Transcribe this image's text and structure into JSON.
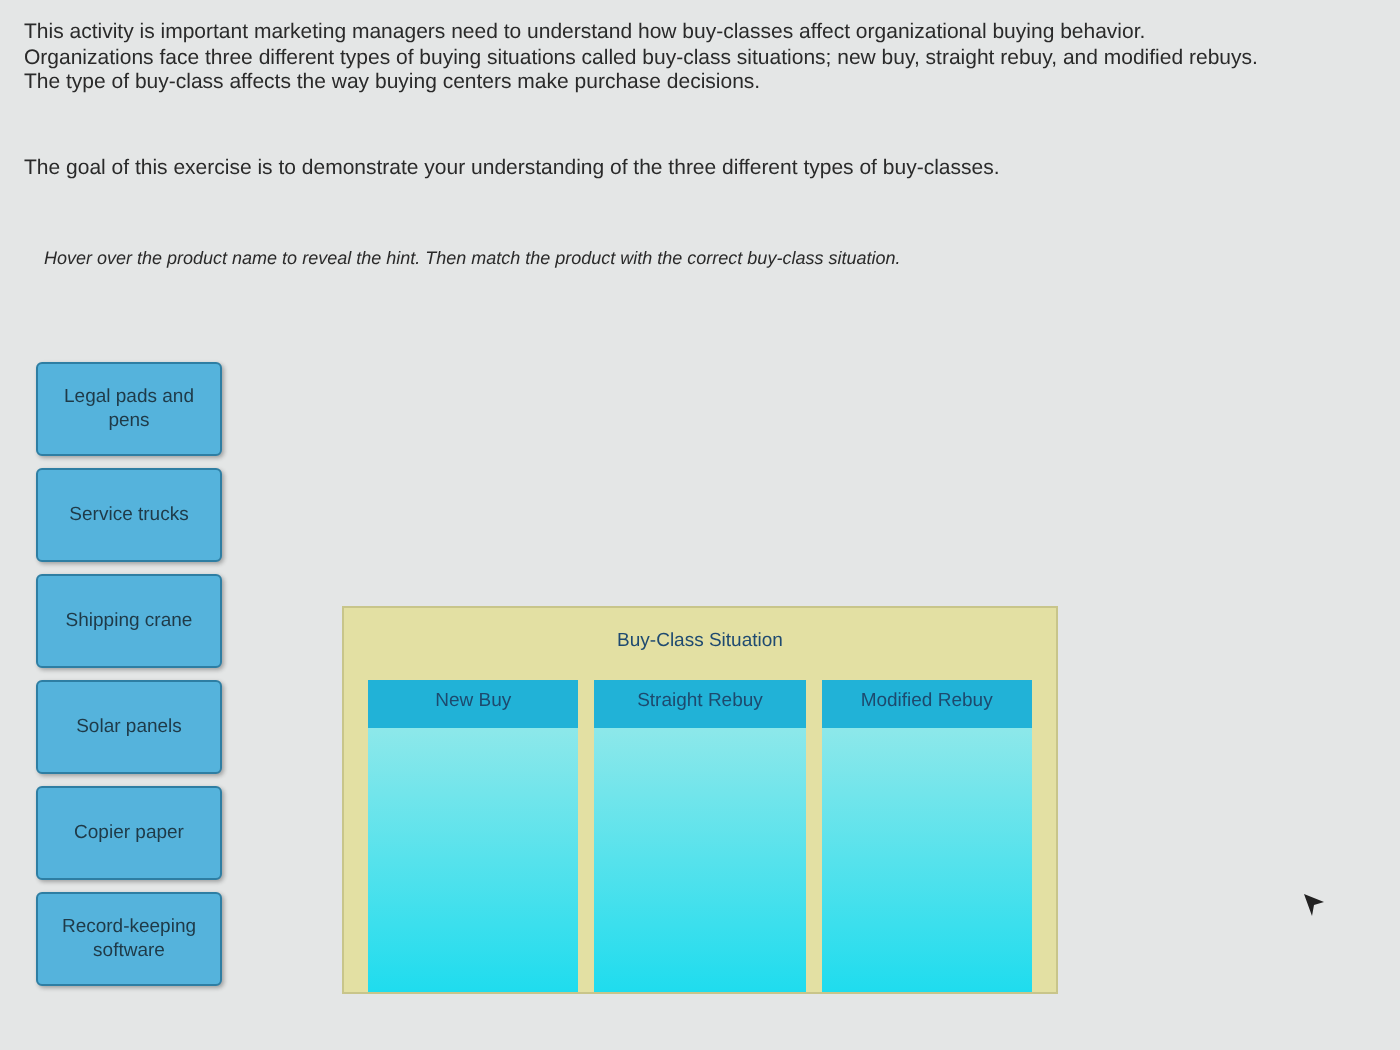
{
  "intro": [
    "This activity is important marketing managers need to understand how buy-classes affect organizational buying behavior.",
    "Organizations face three different types of buying situations called buy-class situations; new buy, straight rebuy, and modified rebuys.",
    "The type of buy-class affects the way buying centers make purchase decisions."
  ],
  "goal": "The goal of this exercise is to demonstrate your understanding of the three different types of buy-classes.",
  "instruction": "Hover over the product name to reveal the hint. Then match the product with the correct buy-class situation.",
  "products": [
    {
      "label": "Legal pads and pens"
    },
    {
      "label": "Service trucks"
    },
    {
      "label": "Shipping crane"
    },
    {
      "label": "Solar panels"
    },
    {
      "label": "Copier paper"
    },
    {
      "label": "Record-keeping software"
    }
  ],
  "panel": {
    "title": "Buy-Class Situation",
    "columns": [
      {
        "label": "New Buy"
      },
      {
        "label": "Straight Rebuy"
      },
      {
        "label": "Modified Rebuy"
      }
    ]
  }
}
